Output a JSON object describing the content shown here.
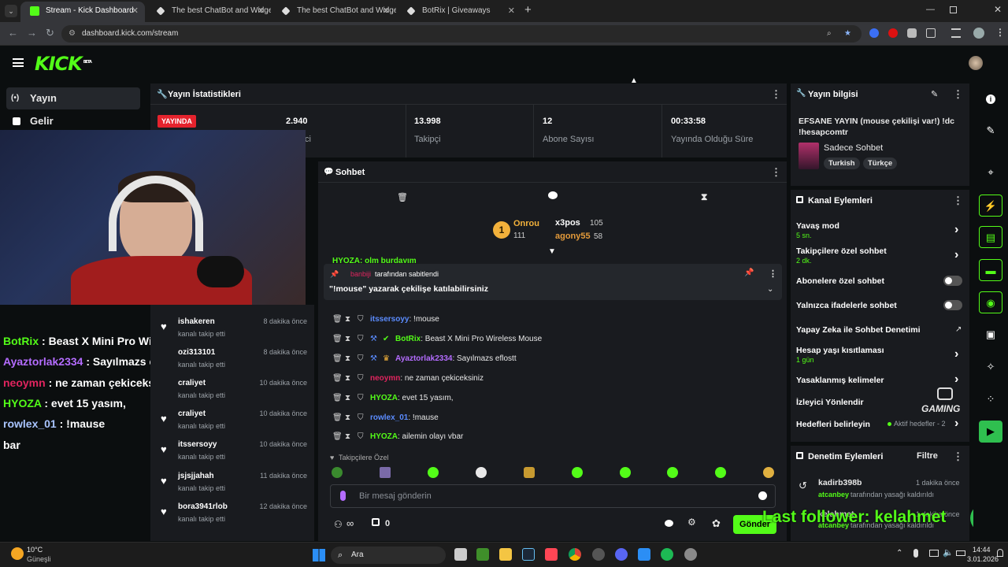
{
  "browser": {
    "tabs": [
      {
        "title": "Stream - Kick Dashboard",
        "active": true
      },
      {
        "title": "The best ChatBot and Widgets",
        "active": false
      },
      {
        "title": "The best ChatBot and Widgets",
        "active": false
      },
      {
        "title": "BotRix | Giveaways",
        "active": false
      }
    ],
    "url": "dashboard.kick.com/stream"
  },
  "kick": {
    "logo": "KICK",
    "beta": "BETA"
  },
  "sidebar": {
    "items": [
      {
        "label": "Yayın"
      },
      {
        "label": "Gelir"
      }
    ]
  },
  "stats": {
    "title": "Yayın İstatistikleri",
    "live_badge": "YAYINDA",
    "items": [
      {
        "value": "2.940",
        "label": "ci"
      },
      {
        "value": "13.998",
        "label": "Takipçi"
      },
      {
        "value": "12",
        "label": "Abone Sayısı"
      },
      {
        "value": "00:33:58",
        "label": "Yayında Olduğu Süre"
      }
    ]
  },
  "chat": {
    "title": "Sohbet",
    "leaderboard": {
      "first": {
        "name": "Onrou",
        "count": "111",
        "rank": "1"
      },
      "second": {
        "name": "x3pos",
        "count": "105"
      },
      "third": {
        "name": "agony55",
        "count": "58"
      }
    },
    "partial_line": "HYOZA: olm burdayım",
    "pinned": {
      "by_user": "banbiji",
      "by_text": "tarafından sabitlendi",
      "message": "\"!mouse\" yazarak çekilişe katılabilirsiniz"
    },
    "messages": [
      {
        "user": "itssersoyy",
        "text": ": !mouse",
        "color": "#5b8cff"
      },
      {
        "user": "BotRix",
        "text": ": Beast X Mini Pro Wireless Mouse",
        "color": "#53fc18"
      },
      {
        "user": "Ayaztorlak2334",
        "text": ": Sayılmazs eflostt",
        "color": "#b46cff"
      },
      {
        "user": "neoymn",
        "text": ": ne zaman çekiceksiniz",
        "color": "#e0245e"
      },
      {
        "user": "HYOZA",
        "text": ": evet 15 yasım,",
        "color": "#53fc18"
      },
      {
        "user": "rowlex_01",
        "text": ": !mause",
        "color": "#5b8cff"
      },
      {
        "user": "HYOZA",
        "text": ": ailemin olayı vbar",
        "color": "#53fc18"
      }
    ],
    "followers_only": "Takipçilere Özel",
    "input_placeholder": "Bir mesaj gönderin",
    "send_label": "Gönder",
    "points": "0"
  },
  "follows": {
    "items": [
      {
        "name": "ishakeren",
        "sub": "kanalı takip etti",
        "time": "8 dakika önce"
      },
      {
        "name": "ozi313101",
        "sub": "kanalı takip etti",
        "time": "8 dakika önce"
      },
      {
        "name": "craliyet",
        "sub": "kanalı takip etti",
        "time": "10 dakika önce"
      },
      {
        "name": "craliyet",
        "sub": "kanalı takip etti",
        "time": "10 dakika önce"
      },
      {
        "name": "itssersoyy",
        "sub": "kanalı takip etti",
        "time": "10 dakika önce"
      },
      {
        "name": "jsjsjjahah",
        "sub": "kanalı takip etti",
        "time": "11 dakika önce"
      },
      {
        "name": "bora3941rlob",
        "sub": "kanalı takip etti",
        "time": "12 dakika önce"
      }
    ]
  },
  "overlay_chat": [
    {
      "user": "BotRix",
      "text": " : Beast X Mini Pro Wireless Mods",
      "color": "#53fc18"
    },
    {
      "user": "Ayaztorlak2334",
      "text": " : Sayılmazs eflostt",
      "color": "#b46cff"
    },
    {
      "user": "neoymn",
      "text": " : ne zaman çekiceksiniz",
      "color": "#e0245e"
    },
    {
      "user": "HYOZA",
      "text": " : evet 15 yasım,",
      "color": "#53fc18"
    },
    {
      "user": "rowlex_01",
      "text": " : !mause",
      "color": "#a9c4ff"
    },
    {
      "user": "",
      "text": "bar",
      "color": "#ffffff"
    }
  ],
  "stream_info": {
    "title": "Yayın bilgisi",
    "stream_title": "EFSANE YAYIN (mouse çekilişi var!) !dc !hesapcomtr",
    "category": "Sadece Sohbet",
    "tags": [
      "Turkish",
      "Türkçe"
    ]
  },
  "channel_actions": {
    "title": "Kanal Eylemleri",
    "slow_mode": {
      "label": "Yavaş mod",
      "value": "5 sn."
    },
    "followers_chat": {
      "label": "Takipçilere özel sohbet",
      "value": "2 dk."
    },
    "subs_chat": "Abonelere özel sohbet",
    "emote_chat": "Yalnızca ifadelerle sohbet",
    "ai_mod": "Yapay Zeka ile Sohbet Denetimi",
    "age_restriction": {
      "label": "Hesap yaşı kısıtlaması",
      "value": "1 gün"
    },
    "banned_words": "Yasaklanmış kelimeler",
    "viewer_redirect": "İzleyici Yönlendir",
    "goals": {
      "label": "Hedefleri belirleyin",
      "value": "Aktif hedefler - 2"
    }
  },
  "moderation": {
    "title": "Denetim Eylemleri",
    "filter": "Filtre",
    "items": [
      {
        "user": "kadirb398b",
        "time": "1 dakika önce",
        "by": "atcanbey",
        "action": "tarafından yasağı kaldırıldı"
      },
      {
        "user": "kelahmet",
        "time": "1 dakika önce",
        "by": "atcanbey",
        "action": "tarafından yasağı kaldırıldı"
      }
    ]
  },
  "watermark": {
    "brand": "GAMING",
    "last_follower": "Last follower: kelahmet"
  },
  "taskbar": {
    "weather_temp": "10°C",
    "weather_desc": "Güneşli",
    "search": "Ara",
    "time": "14:44",
    "date": "3.01.2026"
  }
}
